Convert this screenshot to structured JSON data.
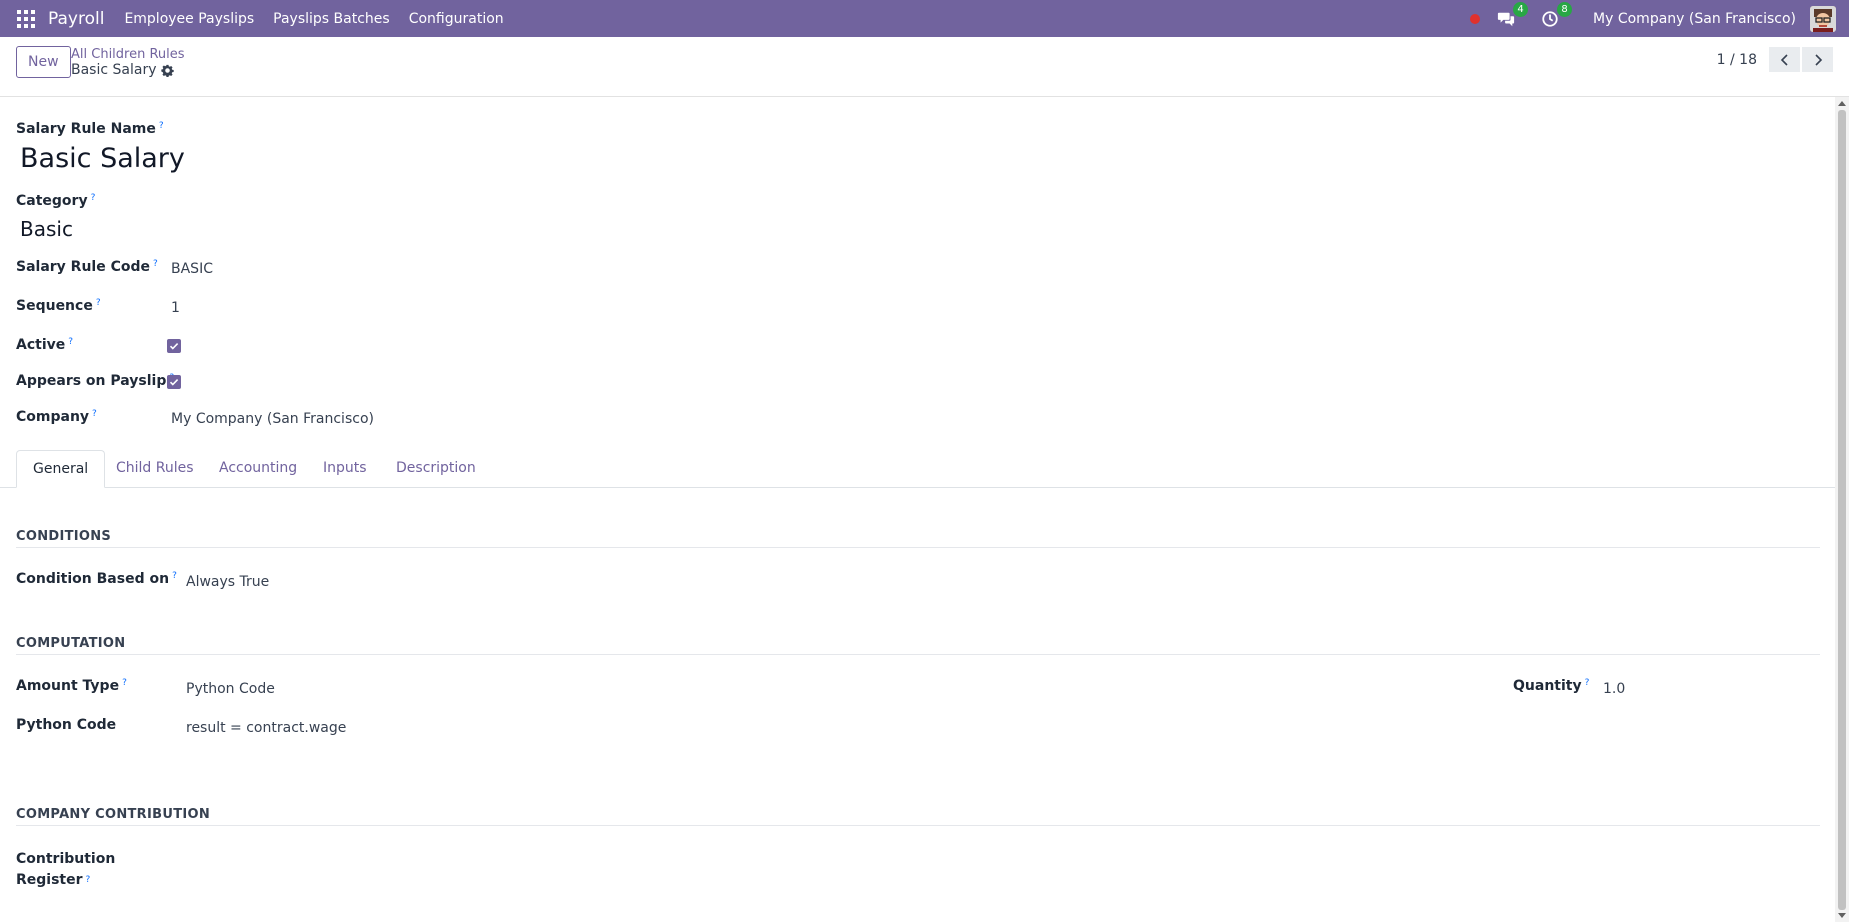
{
  "topbar": {
    "app_name": "Payroll",
    "menu": [
      "Employee Payslips",
      "Payslips Batches",
      "Configuration"
    ],
    "messages_count": "4",
    "activities_count": "8",
    "company": "My Company (San Francisco)",
    "color": "#71639e"
  },
  "control_panel": {
    "new_label": "New",
    "breadcrumb_parent": "All Children Rules",
    "breadcrumb_current": "Basic Salary",
    "pager": "1 / 18"
  },
  "form": {
    "name_label": "Salary Rule Name",
    "name_value": "Basic Salary",
    "category_label": "Category",
    "category_value": "Basic",
    "code_label": "Salary Rule Code",
    "code_value": "BASIC",
    "sequence_label": "Sequence",
    "sequence_value": "1",
    "active_label": "Active",
    "active_checked": true,
    "appears_label": "Appears on Payslip",
    "appears_checked": true,
    "company_label": "Company",
    "company_value": "My Company (San Francisco)",
    "help_mark": "?"
  },
  "tabs": [
    "General",
    "Child Rules",
    "Accounting",
    "Inputs",
    "Description"
  ],
  "general": {
    "conditions_title": "CONDITIONS",
    "condition_label": "Condition Based on",
    "condition_value": "Always True",
    "computation_title": "COMPUTATION",
    "amount_type_label": "Amount Type",
    "amount_type_value": "Python Code",
    "quantity_label": "Quantity",
    "quantity_value": "1.0",
    "python_code_label": "Python Code",
    "python_code_value": "result = contract.wage",
    "contribution_title": "COMPANY CONTRIBUTION",
    "contribution_label_line1": "Contribution",
    "contribution_label_line2": "Register"
  }
}
